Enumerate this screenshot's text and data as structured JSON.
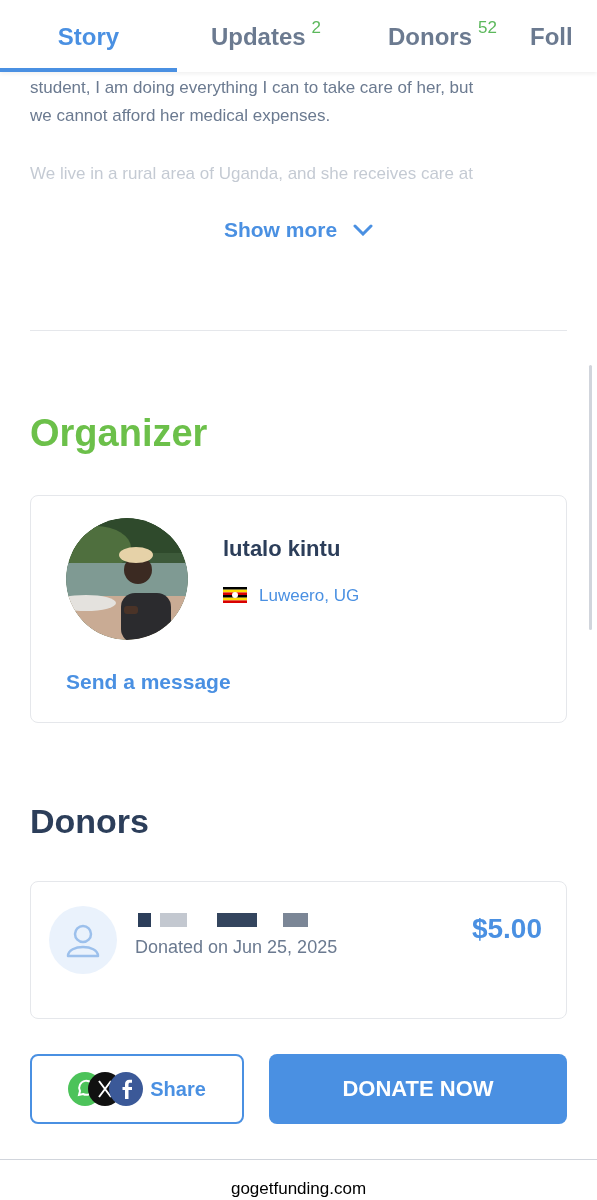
{
  "tabs": [
    {
      "label": "Story",
      "selected": true
    },
    {
      "label": "Updates",
      "badge": "2",
      "selected": false
    },
    {
      "label": "Donors",
      "badge": "52",
      "selected": false
    },
    {
      "label": "Foll",
      "selected": false
    }
  ],
  "story": {
    "lines": [
      "student, I am doing everything I can to take care of her, but",
      "we cannot afford her medical expenses."
    ],
    "faded_line": "We live in a rural area of Uganda, and she receives care at",
    "show_more": "Show more"
  },
  "organizer": {
    "heading": "Organizer",
    "name": "lutalo kintu",
    "location": "Luweero, UG",
    "message_link": "Send a message"
  },
  "donors": {
    "heading": "Donors",
    "items": [
      {
        "date": "Donated on Jun 25, 2025",
        "amount": "$5.00"
      }
    ]
  },
  "bottom_bar": {
    "share": "Share",
    "donate": "DONATE NOW"
  },
  "footer": "gogetfunding.com"
}
